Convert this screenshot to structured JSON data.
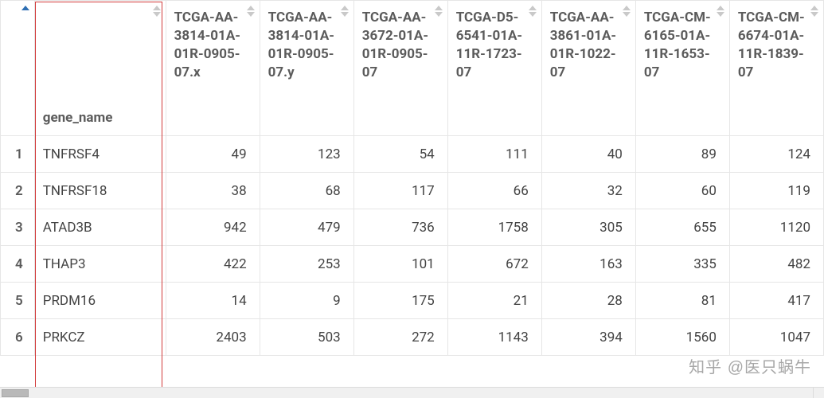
{
  "columns": {
    "rownum": "",
    "gene": "gene_name",
    "c0": "TCGA-AA-3814-01A-01R-0905-07.x",
    "c1": "TCGA-AA-3814-01A-01R-0905-07.y",
    "c2": "TCGA-AA-3672-01A-01R-0905-07",
    "c3": "TCGA-D5-6541-01A-11R-1723-07",
    "c4": "TCGA-AA-3861-01A-01R-1022-07",
    "c5": "TCGA-CM-6165-01A-11R-1653-07",
    "c6": "TCGA-CM-6674-01A-11R-1839-07"
  },
  "rows": [
    {
      "n": "1",
      "gene": "TNFRSF4",
      "v": [
        "49",
        "123",
        "54",
        "111",
        "40",
        "89",
        "124"
      ]
    },
    {
      "n": "2",
      "gene": "TNFRSF18",
      "v": [
        "38",
        "68",
        "117",
        "66",
        "32",
        "60",
        "119"
      ]
    },
    {
      "n": "3",
      "gene": "ATAD3B",
      "v": [
        "942",
        "479",
        "736",
        "1758",
        "305",
        "655",
        "1120"
      ]
    },
    {
      "n": "4",
      "gene": "THAP3",
      "v": [
        "422",
        "253",
        "101",
        "672",
        "163",
        "335",
        "482"
      ]
    },
    {
      "n": "5",
      "gene": "PRDM16",
      "v": [
        "14",
        "9",
        "175",
        "21",
        "28",
        "81",
        "417"
      ]
    },
    {
      "n": "6",
      "gene": "PRKCZ",
      "v": [
        "2403",
        "503",
        "272",
        "1143",
        "394",
        "1560",
        "1047"
      ]
    }
  ],
  "watermark": "知乎 @医只蜗牛"
}
